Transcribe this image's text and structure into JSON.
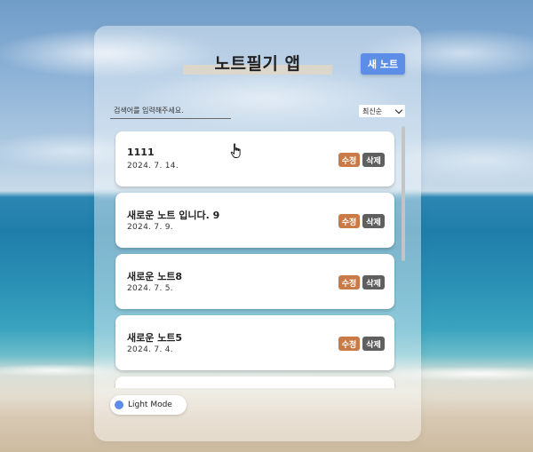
{
  "app": {
    "title": "노트필기 앱",
    "new_note_label": "새 노트"
  },
  "search": {
    "placeholder": "검색어를 입력해주세요."
  },
  "sort": {
    "selected": "최신순"
  },
  "notes": [
    {
      "title": "1111",
      "date": "2024. 7. 14.",
      "edit_label": "수정",
      "delete_label": "삭제"
    },
    {
      "title": "새로운 노트 입니다. 9",
      "date": "2024. 7. 9.",
      "edit_label": "수정",
      "delete_label": "삭제"
    },
    {
      "title": "새로운 노트8",
      "date": "2024. 7. 5.",
      "edit_label": "수정",
      "delete_label": "삭제"
    },
    {
      "title": "새로운 노트5",
      "date": "2024. 7. 4.",
      "edit_label": "수정",
      "delete_label": "삭제"
    }
  ],
  "mode_toggle": {
    "label": "Light Mode"
  },
  "colors": {
    "accent": "#5c8ee8",
    "edit": "#c97a46",
    "delete": "#5f5f5f"
  },
  "icons": {
    "cursor": "hand-pointer-icon",
    "sort": "chevron-down-icon",
    "mode": "mode-dot-icon"
  }
}
